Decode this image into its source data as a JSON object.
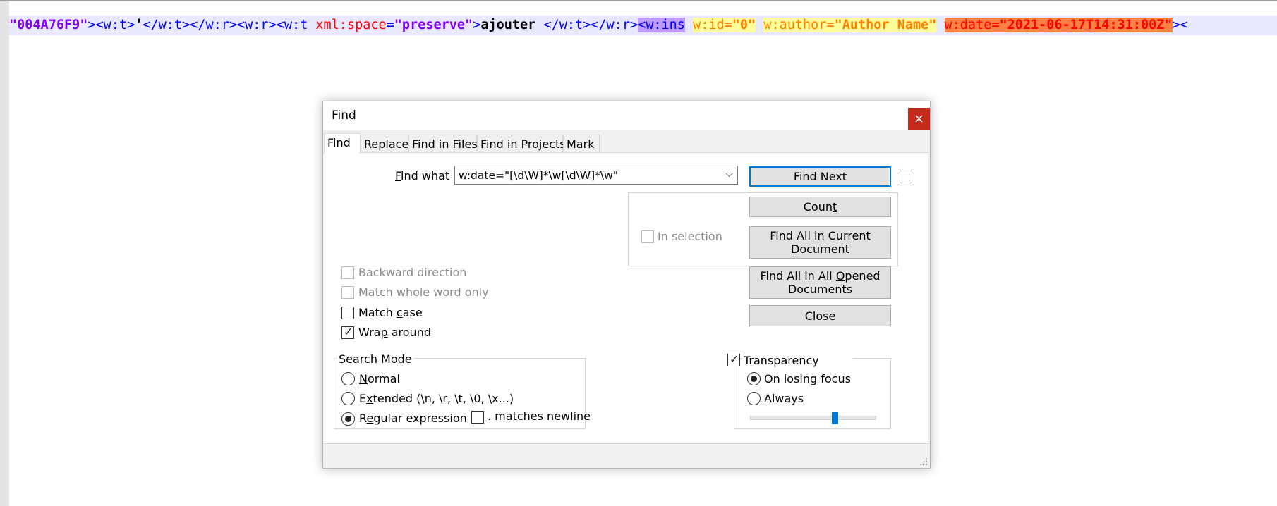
{
  "editor": {
    "segments": [
      {
        "text": "\"004A76F9\"",
        "cls": "xv"
      },
      {
        "text": "><w:t>",
        "cls": ""
      },
      {
        "text": "’",
        "cls": "xt"
      },
      {
        "text": "</w:t></w:r><w:r><w:t ",
        "cls": ""
      },
      {
        "text": "xml:space",
        "cls": "xa"
      },
      {
        "text": "=",
        "cls": ""
      },
      {
        "text": "\"preserve\"",
        "cls": "xv"
      },
      {
        "text": ">",
        "cls": ""
      },
      {
        "text": "ajouter ",
        "cls": "xt"
      },
      {
        "text": "</w:t></w:r>",
        "cls": ""
      },
      {
        "text": "<w:ins",
        "cls": "hl-purple"
      },
      {
        "text": " ",
        "cls": ""
      },
      {
        "text": "w:id",
        "cls": "hl-yellow"
      },
      {
        "text": "=",
        "cls": "hl-yellow"
      },
      {
        "text": "\"0\"",
        "cls": "hl-yellow xv"
      },
      {
        "text": " ",
        "cls": ""
      },
      {
        "text": "w:author",
        "cls": "hl-yellow"
      },
      {
        "text": "=",
        "cls": "hl-yellow"
      },
      {
        "text": "\"Author Name\"",
        "cls": "hl-yellow xv"
      },
      {
        "text": " ",
        "cls": ""
      },
      {
        "text": "w:date",
        "cls": "hl-orange"
      },
      {
        "text": "=",
        "cls": "hl-orange"
      },
      {
        "text": "\"2021-06-17T14:31:00Z\"",
        "cls": "hl-orange xv"
      },
      {
        "text": "><",
        "cls": ""
      }
    ]
  },
  "dialog": {
    "title": "Find",
    "close_glyph": "×",
    "tabs": [
      {
        "label": "Find"
      },
      {
        "label": "Replace"
      },
      {
        "label": "Find in Files"
      },
      {
        "label": "Find in Projects"
      },
      {
        "label": "Mark"
      }
    ],
    "find_what": {
      "label_pre": "",
      "label_u": "F",
      "label_post": "ind what :",
      "value": "w:date=\"[\\d\\W]*\\w[\\d\\W]*\\w\"",
      "arrow_glyph": "⌵"
    },
    "buttons": {
      "find_next": "Find Next",
      "count_pre": "Coun",
      "count_u": "t",
      "count_post": "",
      "find_all_current_line1": "Find All in Current",
      "find_all_current_line2_u": "D",
      "find_all_current_line2_post": "ocument",
      "find_all_opened_line1_pre": "Find All in All ",
      "find_all_opened_line1_u": "O",
      "find_all_opened_line1_post": "pened",
      "find_all_opened_line2": "Documents",
      "close": "Close"
    },
    "options": {
      "in_selection": "In selection",
      "backward_direction": "Backward direction",
      "match_whole_pre": "Match ",
      "match_whole_u": "w",
      "match_whole_post": "hole word only",
      "match_case_pre": "Match ",
      "match_case_u": "c",
      "match_case_post": "ase",
      "wrap_around_pre": "Wra",
      "wrap_around_u": "p",
      "wrap_around_post": " around",
      "check_glyph": "✓"
    },
    "search_mode": {
      "title": "Search Mode",
      "normal_u": "N",
      "normal_post": "ormal",
      "extended_pre": "E",
      "extended_u": "x",
      "extended_post": "tended (\\n, \\r, \\t, \\0, \\x...)",
      "regex_pre": "R",
      "regex_u": "e",
      "regex_post": "gular expression",
      "matches_newline_u": ".",
      "matches_newline_post": " matches newline"
    },
    "transparency": {
      "title": "Transparency",
      "on_losing_focus": "On losing focus",
      "always": "Always",
      "level": 0.68
    }
  }
}
